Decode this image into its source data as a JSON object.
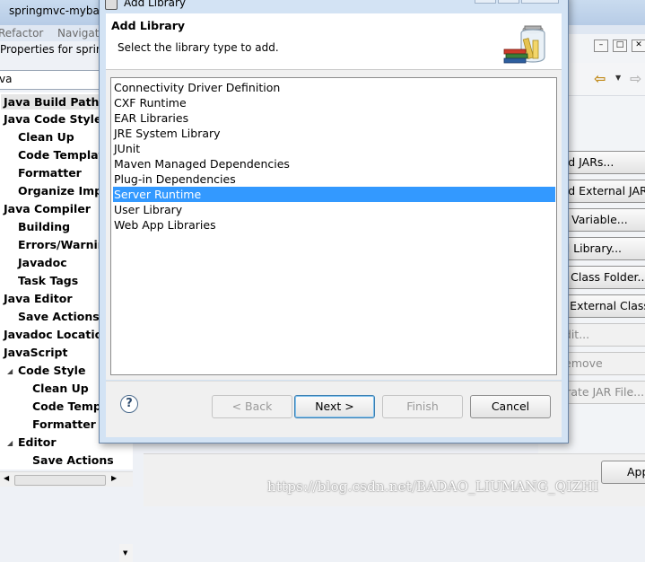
{
  "background_window": {
    "title": "springmvc-mybat",
    "menu": [
      "Refactor",
      "Navigat"
    ],
    "properties_title": "Properties for sprin",
    "filter_value": "va"
  },
  "tree": {
    "items": [
      {
        "label": "Java Build Path",
        "level": 0,
        "selected": true
      },
      {
        "label": "Java Code Style",
        "level": 0
      },
      {
        "label": "Clean Up",
        "level": 1
      },
      {
        "label": "Code Template",
        "level": 1
      },
      {
        "label": "Formatter",
        "level": 1
      },
      {
        "label": "Organize Impo",
        "level": 1
      },
      {
        "label": "Java Compiler",
        "level": 0
      },
      {
        "label": "Building",
        "level": 1
      },
      {
        "label": "Errors/Warning",
        "level": 1
      },
      {
        "label": "Javadoc",
        "level": 1
      },
      {
        "label": "Task Tags",
        "level": 1
      },
      {
        "label": "Java Editor",
        "level": 0
      },
      {
        "label": "Save Actions",
        "level": 1
      },
      {
        "label": "Javadoc Location",
        "level": 0
      },
      {
        "label": "JavaScript",
        "level": 0
      },
      {
        "label": "Code Style",
        "level": 1
      },
      {
        "label": "Clean Up",
        "level": 2
      },
      {
        "label": "Code Templ",
        "level": 2
      },
      {
        "label": "Formatter",
        "level": 2
      },
      {
        "label": "Editor",
        "level": 1
      },
      {
        "label": "Save Actions",
        "level": 2
      }
    ]
  },
  "right_buttons": [
    {
      "label": "Add JARs...",
      "enabled": true
    },
    {
      "label": "Add External JARs...",
      "enabled": true
    },
    {
      "label": "Add Variable...",
      "enabled": true
    },
    {
      "label": "Add Library...",
      "enabled": true
    },
    {
      "label": "Add Class Folder...",
      "enabled": true
    },
    {
      "label": "Add External Class Folder...",
      "enabled": true
    },
    {
      "label": "Edit...",
      "enabled": false
    },
    {
      "label": "Remove",
      "enabled": false
    },
    {
      "label": "Migrate JAR File...",
      "enabled": false
    }
  ],
  "apply_label": "Apply",
  "watermark": "https://blog.csdn.net/BADAO_LIUMANG_QIZHI",
  "dialog": {
    "title": "Add Library",
    "heading": "Add Library",
    "subheading": "Select the library type to add.",
    "library_types": [
      "Connectivity Driver Definition",
      "CXF Runtime",
      "EAR Libraries",
      "JRE System Library",
      "JUnit",
      "Maven Managed Dependencies",
      "Plug-in Dependencies",
      "Server Runtime",
      "User Library",
      "Web App Libraries"
    ],
    "selected_index": 7,
    "buttons": {
      "back": "< Back",
      "next": "Next >",
      "finish": "Finish",
      "cancel": "Cancel"
    }
  },
  "colors": {
    "selection": "#3399ff",
    "dialog_frame": "#d3e3f4"
  }
}
